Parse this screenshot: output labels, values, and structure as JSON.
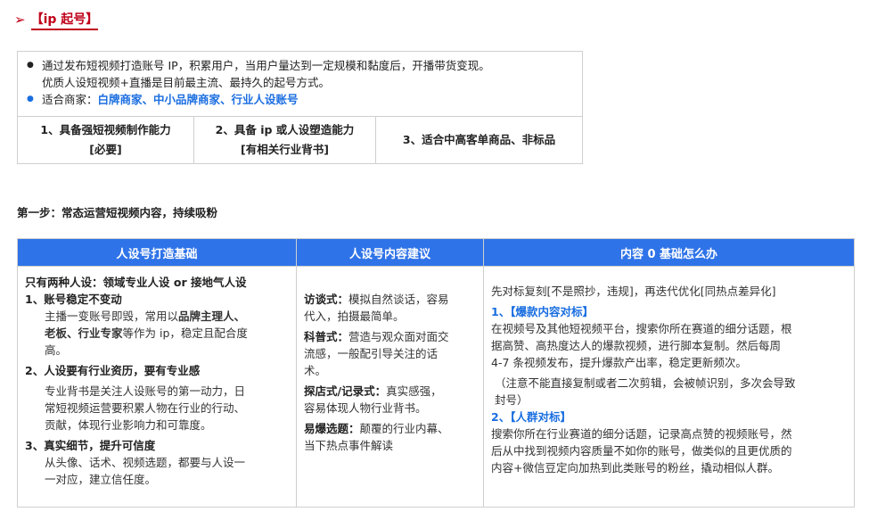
{
  "heading": {
    "arrow": "➢",
    "title": "【ip 起号】"
  },
  "intro": {
    "bullet1": "通过发布短视频打造账号 IP，积累用户，当用户量达到一定规模和黏度后，开播带货变现。",
    "bullet1_cont": "优质人设短视频+直播是目前最主流、最持久的起号方式。",
    "bullet2_prefix": "适合商家：",
    "bullet2_highlight": "白牌商家、中小品牌商家、行业人设账号",
    "req1_line1": "1、具备强短视频制作能力",
    "req1_line2": "[必要]",
    "req2_line1": "2、具备 ip 或人设塑造能力",
    "req2_line2": "[有相关行业背书]",
    "req3": "3、适合中高客单商品、非标品"
  },
  "step": "第一步：常态运营短视频内容，持续吸粉",
  "table": {
    "headers": [
      "人设号打造基础",
      "人设号内容建议",
      "内容 0 基础怎么办"
    ],
    "col1": {
      "intro": "只有两种人设：领域专业人设 or 接地气人设",
      "item1_title": "1、账号稳定不变动",
      "item1_a": "主播一变账号即毁，常用以",
      "item1_b": "品牌主理人、",
      "item1_c": "老板、行业专家",
      "item1_d": "等作为 ip，稳定且配合度",
      "item1_e": "高。",
      "item2_title": "2、人设要有行业资历，要有专业感",
      "item2_a": "专业背书是关注人设账号的第一动力，日",
      "item2_b": "常短视频运营要积累人物在行业的行动、",
      "item2_c": "贡献，体现行业影响力和可靠度。",
      "item3_title": "3、真实细节，提升可信度",
      "item3_a": "从头像、话术、视频选题，都要与人设一",
      "item3_b": "一对应，建立信任度。"
    },
    "col2": {
      "t1_label": "访谈式：",
      "t1_text_a": "模拟自然谈话，容易",
      "t1_text_b": "代入，拍摄最简单。",
      "t2_label": "科普式：",
      "t2_text_a": "营造与观众面对面交",
      "t2_text_b": "流感，一般配引导关注的话",
      "t2_text_c": "术。",
      "t3_label": "探店式/记录式：",
      "t3_text_a": "真实感强，",
      "t3_text_b": "容易体现人物行业背书。",
      "t4_label": "易爆选题：",
      "t4_text_a": "颠覆的行业内幕、",
      "t4_text_b": "当下热点事件解读"
    },
    "col3": {
      "intro": "先对标复刻[不是照抄，违规]，再迭代优化[同热点差异化]",
      "s1_title": "1、【爆款内容对标】",
      "s1_a": "在视频号及其他短视频平台，搜索你所在赛道的细分话题，根",
      "s1_b": "据高赞、高热度达人的爆款视频，进行脚本复制。然后每周",
      "s1_c": "4-7 条视频发布，提升爆款产出率，稳定更新频次。",
      "s1_note_a": "（注意不能直接复制或者二次剪辑，会被帧识别，多次会导致",
      "s1_note_b": "封号）",
      "s2_title": "2、【人群对标】",
      "s2_a": "搜索你所在行业赛道的细分话题，记录高点赞的视频账号，然",
      "s2_b": "后从中找到视频内容质量不如你的账号，做类似的且更优质的",
      "s2_c": "内容+微信豆定向加热到此类账号的粉丝，撬动相似人群。"
    }
  },
  "colors": {
    "accent_red": "#c0001a",
    "header_blue": "#2f73e8",
    "link_blue": "#1a6ee0"
  }
}
